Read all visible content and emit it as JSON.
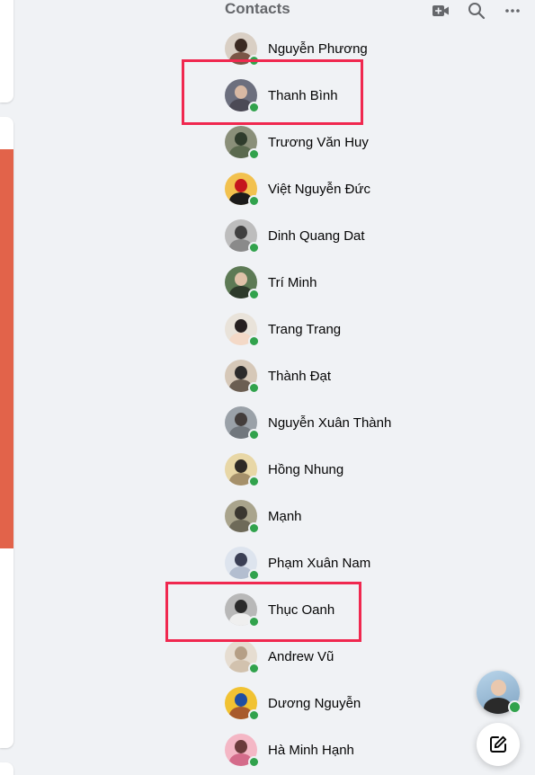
{
  "contacts": {
    "title": "Contacts",
    "header_icons": [
      "new-room-video-icon",
      "search-icon",
      "more-options-icon"
    ],
    "items": [
      {
        "name": "Nguyễn Phương",
        "online": true
      },
      {
        "name": "Thanh Bình",
        "online": true
      },
      {
        "name": "Trương Văn Huy",
        "online": true
      },
      {
        "name": "Việt Nguyễn Đức",
        "online": true
      },
      {
        "name": "Dinh Quang Dat",
        "online": true
      },
      {
        "name": "Trí Minh",
        "online": true
      },
      {
        "name": "Trang Trang",
        "online": true
      },
      {
        "name": "Thành Đạt",
        "online": true
      },
      {
        "name": "Nguyễn Xuân Thành",
        "online": true
      },
      {
        "name": "Hồng Nhung",
        "online": true
      },
      {
        "name": "Mạnh",
        "online": true
      },
      {
        "name": "Phạm Xuân Nam",
        "online": true
      },
      {
        "name": "Thục Oanh",
        "online": true
      },
      {
        "name": "Andrew Vũ",
        "online": true
      },
      {
        "name": "Dương Nguyễn",
        "online": true
      },
      {
        "name": "Hà Minh Hạnh",
        "online": true
      }
    ],
    "highlighted": [
      "Thanh Bình",
      "Thục Oanh"
    ]
  },
  "floating": {
    "chat_head_online": true,
    "compose_icon": "new-message-icon"
  },
  "colors": {
    "background": "#f0f2f5",
    "text_primary": "#050505",
    "text_secondary": "#65676b",
    "online": "#31a24c",
    "highlight": "#f0284f",
    "feed_image": "#e2634a"
  }
}
